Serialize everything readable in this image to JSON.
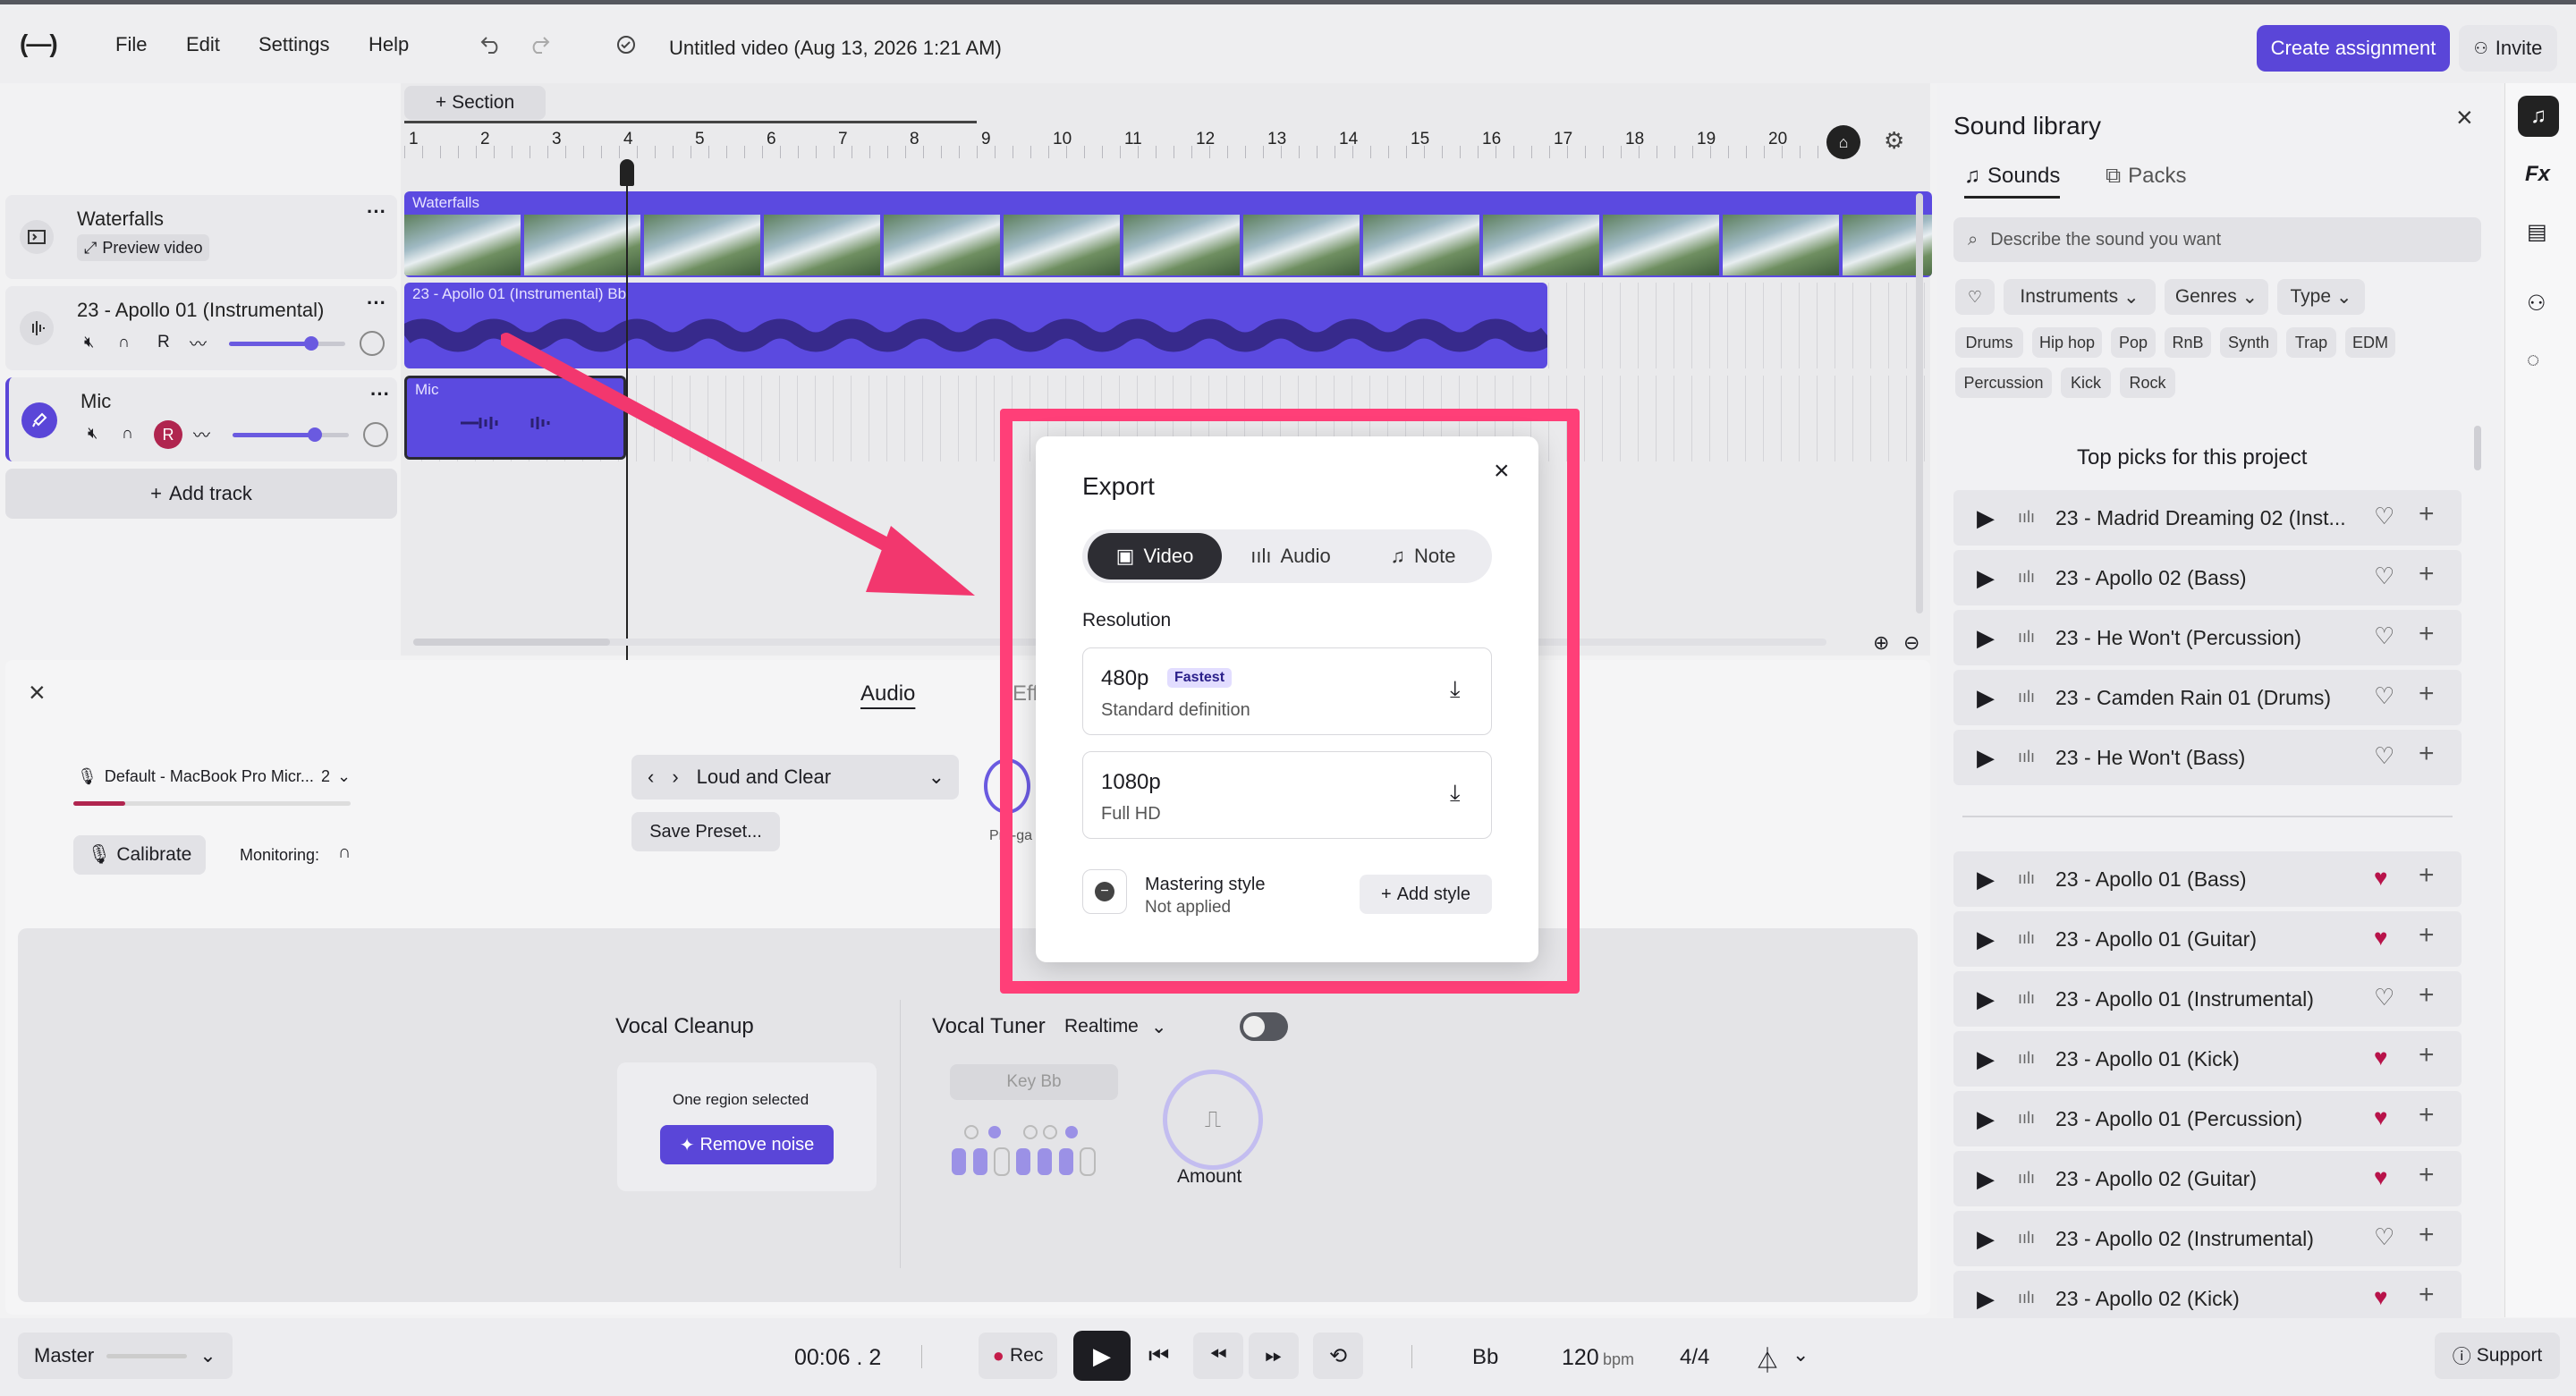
{
  "menubar": {
    "file": "File",
    "edit": "Edit",
    "settings": "Settings",
    "help": "Help",
    "title": "Untitled video (Aug 13, 2026 1:21 AM)",
    "create_assignment": "Create assignment",
    "invite": "Invite"
  },
  "timeline": {
    "section_button": "Section",
    "ruler": [
      "1",
      "2",
      "3",
      "4",
      "5",
      "6",
      "7",
      "8",
      "9",
      "10",
      "11",
      "12",
      "13",
      "14",
      "15",
      "16",
      "17",
      "18",
      "19",
      "20"
    ]
  },
  "tracks": [
    {
      "name": "Waterfalls",
      "sub": "Preview video",
      "clip": "Waterfalls"
    },
    {
      "name": "23 - Apollo 01 (Instrumental)",
      "clip": "23 - Apollo 01 (Instrumental) Bb",
      "rec": "R"
    },
    {
      "name": "Mic",
      "clip": "Mic",
      "rec": "R"
    }
  ],
  "add_track": "Add track",
  "bottom_panel": {
    "tab_audio": "Audio",
    "tab_effects": "Eff",
    "input_device": "Default - MacBook Pro Micr...",
    "input_channel": "2",
    "calibrate": "Calibrate",
    "monitoring": "Monitoring:",
    "preset": "Loud and Clear",
    "save_preset": "Save Preset...",
    "pregain": "Pre-ga",
    "vocal_cleanup": "Vocal Cleanup",
    "one_region": "One region selected",
    "remove_noise": "Remove noise",
    "vocal_tuner": "Vocal Tuner",
    "realtime": "Realtime",
    "key": "Key Bb",
    "amount": "Amount"
  },
  "sound_library": {
    "title": "Sound library",
    "tab_sounds": "Sounds",
    "tab_packs": "Packs",
    "search_placeholder": "Describe the sound you want",
    "filters": [
      "Instruments",
      "Genres",
      "Type"
    ],
    "tags": [
      "Drums",
      "Hip hop",
      "Pop",
      "RnB",
      "Synth",
      "Trap",
      "EDM",
      "Percussion",
      "Kick",
      "Rock"
    ],
    "top_picks": "Top picks for this project",
    "picks": [
      {
        "name": "23 - Madrid Dreaming 02 (Inst...",
        "liked": false
      },
      {
        "name": "23 - Apollo 02 (Bass)",
        "liked": false
      },
      {
        "name": "23 - He Won't (Percussion)",
        "liked": false
      },
      {
        "name": "23 - Camden Rain 01 (Drums)",
        "liked": false
      },
      {
        "name": "23 - He Won't (Bass)",
        "liked": false
      }
    ],
    "liked": [
      {
        "name": "23 - Apollo 01 (Bass)",
        "liked": true
      },
      {
        "name": "23 - Apollo 01 (Guitar)",
        "liked": true
      },
      {
        "name": "23 - Apollo 01 (Instrumental)",
        "liked": false
      },
      {
        "name": "23 - Apollo 01 (Kick)",
        "liked": true
      },
      {
        "name": "23 - Apollo 01 (Percussion)",
        "liked": true
      },
      {
        "name": "23 - Apollo 02 (Guitar)",
        "liked": true
      },
      {
        "name": "23 - Apollo 02 (Instrumental)",
        "liked": false
      },
      {
        "name": "23 - Apollo 02 (Kick)",
        "liked": true
      }
    ]
  },
  "export": {
    "title": "Export",
    "tab_video": "Video",
    "tab_audio": "Audio",
    "tab_note": "Note",
    "resolution_label": "Resolution",
    "options": [
      {
        "res": "480p",
        "badge": "Fastest",
        "desc": "Standard definition"
      },
      {
        "res": "1080p",
        "badge": "",
        "desc": "Full HD"
      }
    ],
    "mastering": "Mastering style",
    "mastering_status": "Not applied",
    "add_style": "Add style"
  },
  "bottombar": {
    "master": "Master",
    "time": "00:06 . 2",
    "rec": "Rec",
    "key": "Bb",
    "bpm": "120",
    "bpm_unit": "bpm",
    "meter": "4/4",
    "support": "Support"
  },
  "rail": {
    "fx": "Fx"
  },
  "colors": {
    "accent": "#5a46d8",
    "clip": "#5b4ae0",
    "highlight": "#ff3f78",
    "liked_heart": "#b8134a"
  }
}
